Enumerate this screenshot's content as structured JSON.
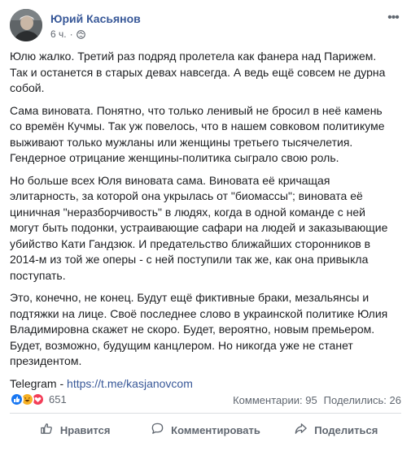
{
  "post": {
    "author": "Юрий Касьянов",
    "time": "6 ч.",
    "privacy_icon": "globe-icon",
    "more_icon": "ellipsis-icon",
    "paragraphs": [
      "Юлю жалко. Третий раз подряд пролетела как фанера над Парижем. Так и останется в старых девах навсегда. А ведь ещё совсем не дурна собой.",
      "Сама виновата. Понятно, что только ленивый не бросил в неё камень со времён Кучмы. Так уж повелось, что в нашем совковом политикуме выживают только мужланы или женщины третьего тысячелетия. Гендерное отрицание женщины-политика сыграло свою роль.",
      "Но больше всех Юля виновата сама. Виновата её кричащая элитарность, за которой она укрылась от \"биомассы\"; виновата её циничная \"неразборчивость\" в людях, когда в одной команде с ней могут быть подонки, устраивающие сафари на людей и заказывающие убийство Кати Гандзюк. И предательство ближайших сторонников в 2014-м из той же оперы - с ней поступили так же, как она привыкла поступать.",
      "Это, конечно, не конец. Будут ещё фиктивные браки, мезальянсы и подтяжки на лице. Своё последнее слово в украинской политике Юлия Владимировна скажет не скоро. Будет, вероятно, новым премьером. Будет, возможно, будущим канцлером. Но никогда уже не станет президентом."
    ],
    "telegram_prefix": "Telegram - ",
    "telegram_link": "https://t.me/kasjanovcom"
  },
  "stats": {
    "reactions": [
      "like",
      "haha",
      "love"
    ],
    "reactions_count": "651",
    "comments": "Комментарии: 95",
    "shares": "Поделились: 26"
  },
  "actions": {
    "like": "Нравится",
    "comment": "Комментировать",
    "share": "Поделиться"
  },
  "colors": {
    "link": "#385898",
    "text": "#1c1e21",
    "muted": "#606770",
    "like": "#1877f2",
    "love": "#f33e58",
    "haha": "#f7b125"
  }
}
